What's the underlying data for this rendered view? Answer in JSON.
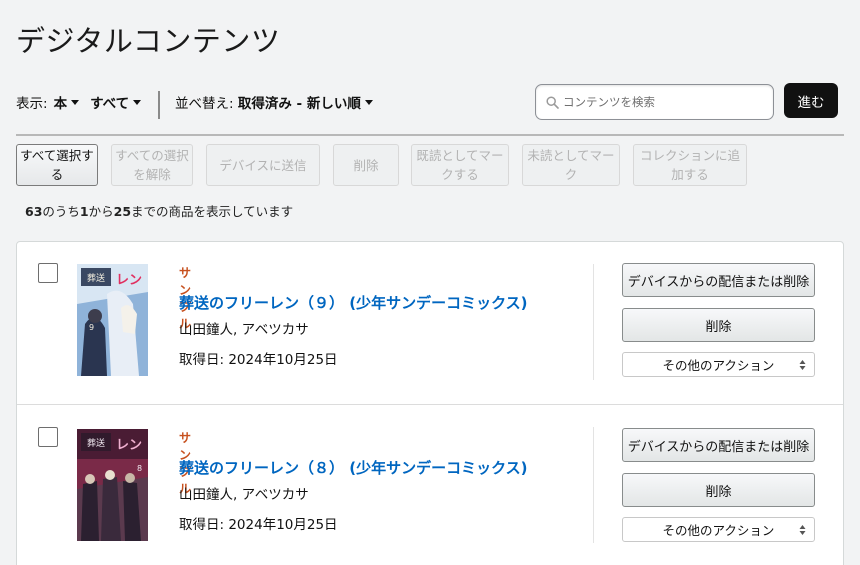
{
  "page": {
    "title": "デジタルコンテンツ"
  },
  "filters": {
    "display_label": "表示:",
    "type_value": "本",
    "scope_value": "すべて",
    "sort_label": "並べ替え:",
    "sort_value": "取得済み - 新しい順"
  },
  "search": {
    "placeholder": "コンテンツを検索",
    "go_label": "進む"
  },
  "bulk_actions": {
    "select_all": "すべて選択する",
    "deselect_all": "すべての選択を解除",
    "send_to_device": "デバイスに送信",
    "delete": "削除",
    "mark_read": "既読としてマークする",
    "mark_unread": "未読としてマーク",
    "add_to_collection": "コレクションに追加する"
  },
  "summary": {
    "total": "63",
    "text_a": "のうち",
    "from": "1",
    "text_b": "から",
    "to": "25",
    "text_c": "までの商品を表示しています"
  },
  "items": [
    {
      "badge": "サンプル",
      "title": "葬送のフリーレン（９） (少年サンデーコミックス)",
      "authors": "山田鐘人, アベツカサ",
      "acquired": "取得日: 2024年10月25日",
      "cover_volume": "9",
      "cover_colors": {
        "sky": "#8fb3d9",
        "accent": "#2a3550",
        "text": "#f5f0e0"
      },
      "btn_remove_device": "デバイスからの配信または削除",
      "btn_delete": "削除",
      "btn_more": "その他のアクション"
    },
    {
      "badge": "サンプル",
      "title": "葬送のフリーレン（８） (少年サンデーコミックス)",
      "authors": "山田鐘人, アベツカサ",
      "acquired": "取得日: 2024年10月25日",
      "cover_volume": "8",
      "cover_colors": {
        "sky": "#7a2a48",
        "accent": "#2b2030",
        "text": "#f0e8f0"
      },
      "btn_remove_device": "デバイスからの配信または削除",
      "btn_delete": "削除",
      "btn_more": "その他のアクション"
    }
  ]
}
